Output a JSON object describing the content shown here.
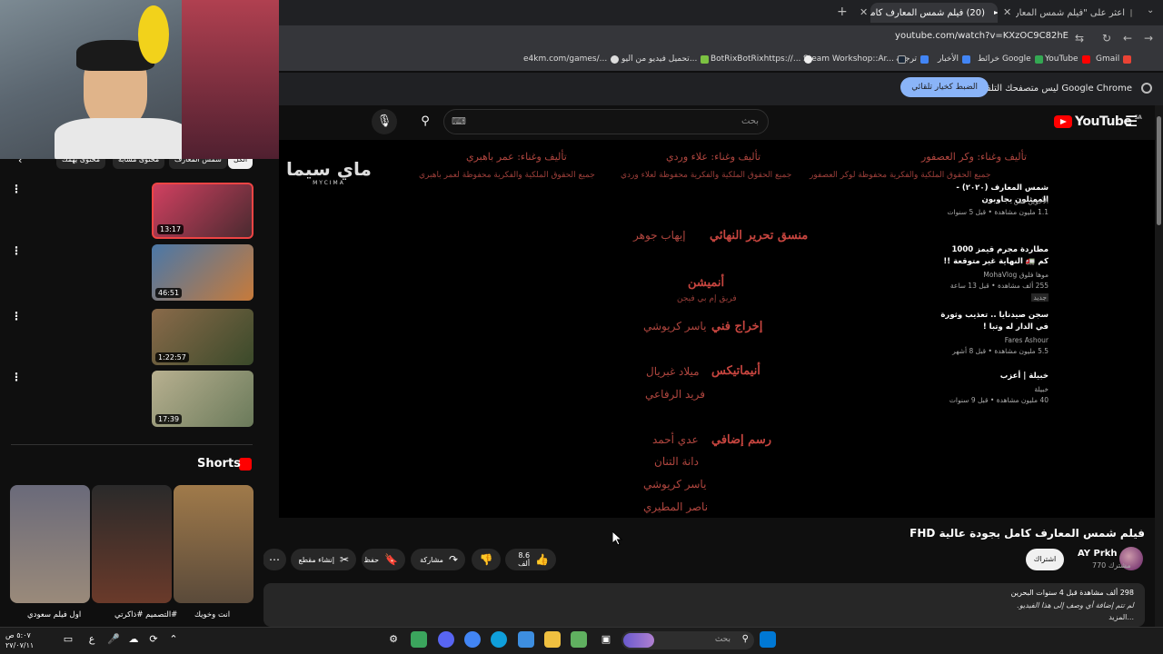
{
  "browser": {
    "tabs": [
      {
        "title": "اعثر على \"فيلم شمس المعارف\" ع...",
        "active": false
      },
      {
        "title": "(20) فيلم شمس المعارف كامل بـ...",
        "active": true
      }
    ],
    "url": "youtube.com/watch?v=KXzOC9C82hE",
    "bookmarks": [
      "Gmail",
      "YouTube",
      "خرائط Google",
      "الأخبار",
      "ترجمة",
      "Steam Workshop::Ar...",
      "BotRixBotRixhttps://...",
      "تحميل فيديو من اليو...",
      "e4km.com/games/..."
    ],
    "infobar_text": "Google Chrome ليس متصفحك التلقائي",
    "infobar_button": "الضبط كخيار تلقائي"
  },
  "youtube": {
    "logo": "YouTube",
    "logo_sup": "SA",
    "search_placeholder": "بحث",
    "keyboard_icon": "⌨",
    "video_title": "فيلم شمس المعارف كامل بجودة عالية FHD",
    "channel": "AY Prkh",
    "subscribers": "770 مشترك",
    "subscribe": "اشتراك",
    "likes": "8.6 ألف",
    "share": "مشاركة",
    "save": "حفظ",
    "clip": "إنشاء مقطع",
    "description": {
      "meta": "298 ألف مشاهدة  قبل 4 سنوات  البحرين",
      "text": "لم تتم إضافة أي وصف إلى هذا الفيديو.",
      "more": "...المزيد"
    }
  },
  "player_credits": {
    "logo_ar": "ماي سيما",
    "logo_en": "MYCIMA",
    "top_rows": [
      {
        "line1": "تأليف وغناء: وكر العصفور",
        "line2": "جميع الحقوق الملكية والفكرية محفوظة لوكر العصفور"
      },
      {
        "line1": "تأليف وغناء: علاء وردي",
        "line2": "جميع الحقوق الملكية والفكرية محفوظة لعلاء وردي"
      },
      {
        "line1": "تأليف وغناء: عمر باهبري",
        "line2": "جميع الحقوق الملكية والفكرية محفوظة لعمر باهبري"
      }
    ],
    "editor_role": "منسق تحرير النهائي",
    "editor_name": "إيهاب جوهر",
    "animation_role": "أنميشن",
    "animation_sub": "فريق إم بي فيجن",
    "tech_role": "إخراج فني",
    "tech_name": "ياسر كريوشي",
    "anim_role": "أنيماتيكس",
    "anim_names": [
      "ميلاد غبريال",
      "فريد الرفاعي"
    ],
    "extra_role": "رسم إضافي",
    "extra_names": [
      "عدي أحمد",
      "دانة التنان",
      "ياسر كريوشي",
      "ناصر المطيري"
    ]
  },
  "sidebar": {
    "chips": [
      "الكل",
      "شمس المعارف",
      "محتوى مشابه",
      "محتوى يهمك"
    ],
    "videos": [
      {
        "title": "شمس المعارف (٢٠٢٠) - الممثلون يجاوبون",
        "channel": "الأخوين قس",
        "meta": "1.1 مليون مشاهدة • قبل 5 سنوات",
        "duration": "13:17",
        "colors": [
          "#d04060",
          "#4a2a30"
        ]
      },
      {
        "title": "مطاردة مجرم قيمز 1000 كم 🚛 النهاية غير متوقعة !!",
        "channel": "موها فلوق MohaVlog",
        "meta": "255 ألف مشاهدة • قبل 13 ساعة",
        "badge": "جديد",
        "duration": "46:51",
        "colors": [
          "#4a78a8",
          "#c77a3a"
        ]
      },
      {
        "title": "سجن صيدنايا .. تعذيب وثورة في الدار له وتبا !",
        "channel": "Fares Ashour",
        "meta": "5.5 مليون مشاهدة • قبل 8 أشهر",
        "duration": "1:22:57",
        "colors": [
          "#8a6a4a",
          "#3a4a2a"
        ]
      },
      {
        "title": "خبيلة | أعزب",
        "channel": "خبيلة",
        "meta": "40 مليون مشاهدة • قبل 9 سنوات",
        "duration": "17:39",
        "colors": [
          "#b8b090",
          "#6a7a5a"
        ]
      }
    ],
    "shorts_heading": "Shorts",
    "shorts": [
      {
        "title": "انت وخويك",
        "colors": [
          "#a07a4a",
          "#5a4a3a"
        ]
      },
      {
        "title": "#التصميم #ذاكرتي",
        "colors": [
          "#2a2a2a",
          "#6a3a2a"
        ]
      },
      {
        "title": "اول فيلم سعودي",
        "colors": [
          "#6a6a7a",
          "#9a8a7a"
        ]
      }
    ]
  },
  "taskbar": {
    "search_placeholder": "بحث",
    "time": "٥:٠٧ ص",
    "date": "٢٧/٠٧/١١"
  }
}
